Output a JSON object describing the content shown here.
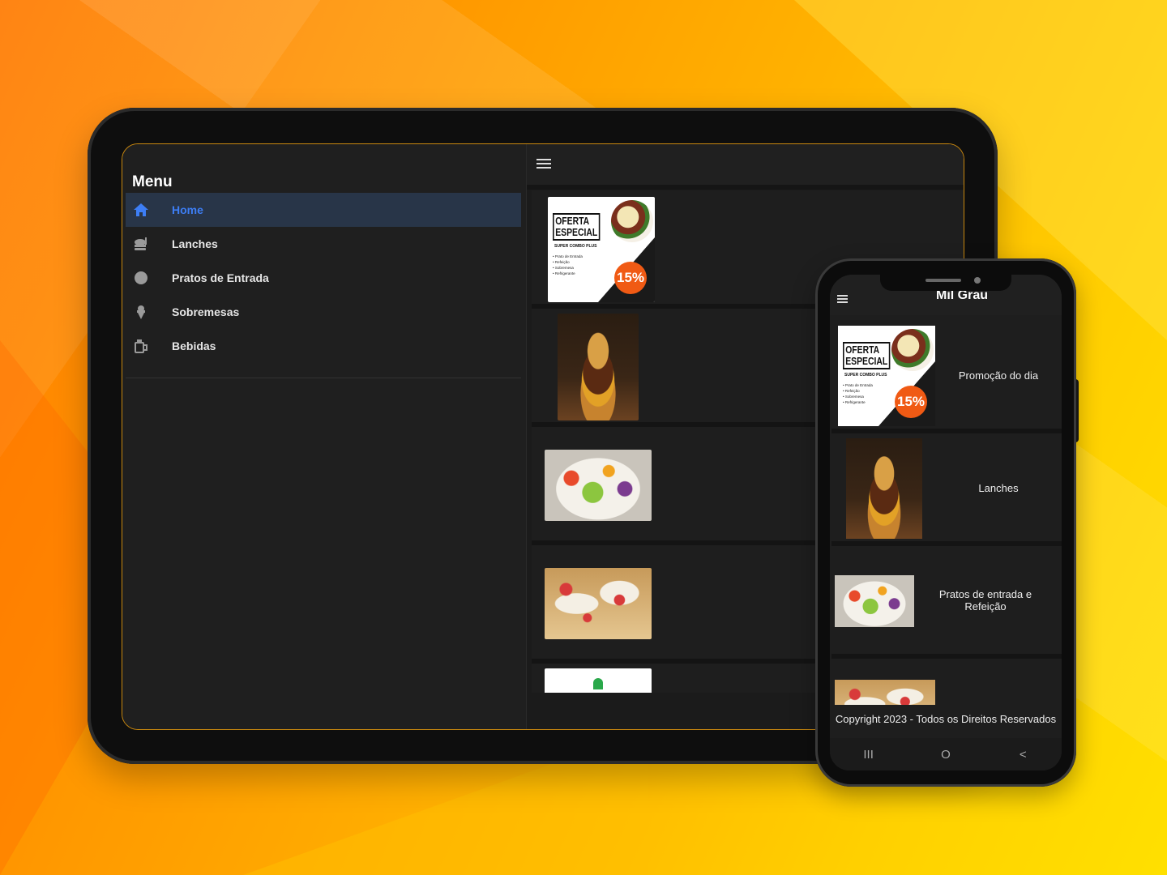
{
  "tablet": {
    "sidebar": {
      "title": "Menu",
      "items": [
        {
          "label": "Home",
          "icon": "home-icon",
          "active": true
        },
        {
          "label": "Lanches",
          "icon": "burger-icon",
          "active": false
        },
        {
          "label": "Pratos de Entrada",
          "icon": "circle-icon",
          "active": false
        },
        {
          "label": "Sobremesas",
          "icon": "ice-cream-icon",
          "active": false
        },
        {
          "label": "Bebidas",
          "icon": "drink-icon",
          "active": false
        }
      ]
    },
    "promo": {
      "title_line1": "OFERTA",
      "title_line2": "ESPECIAL",
      "subtitle": "SUPER COMBO PLUS",
      "bullets": [
        "Prato de Entrada",
        "Refeição",
        "Sobremesa",
        "Refrigerante"
      ],
      "discount": "15%"
    }
  },
  "phone": {
    "title": "Mil Grau",
    "cards": [
      {
        "label": "Promoção do dia"
      },
      {
        "label": "Lanches"
      },
      {
        "label": "Pratos de entrada e Refeição"
      }
    ],
    "footer": "Copyright 2023 - Todos os Direitos Reservados",
    "nav": {
      "recent": "III",
      "home": "O",
      "back": "<"
    }
  },
  "colors": {
    "accent": "#3d7ef5",
    "active_bg": "#283548",
    "discount_badge": "#f05a14",
    "tablet_border": "#c9880f"
  }
}
